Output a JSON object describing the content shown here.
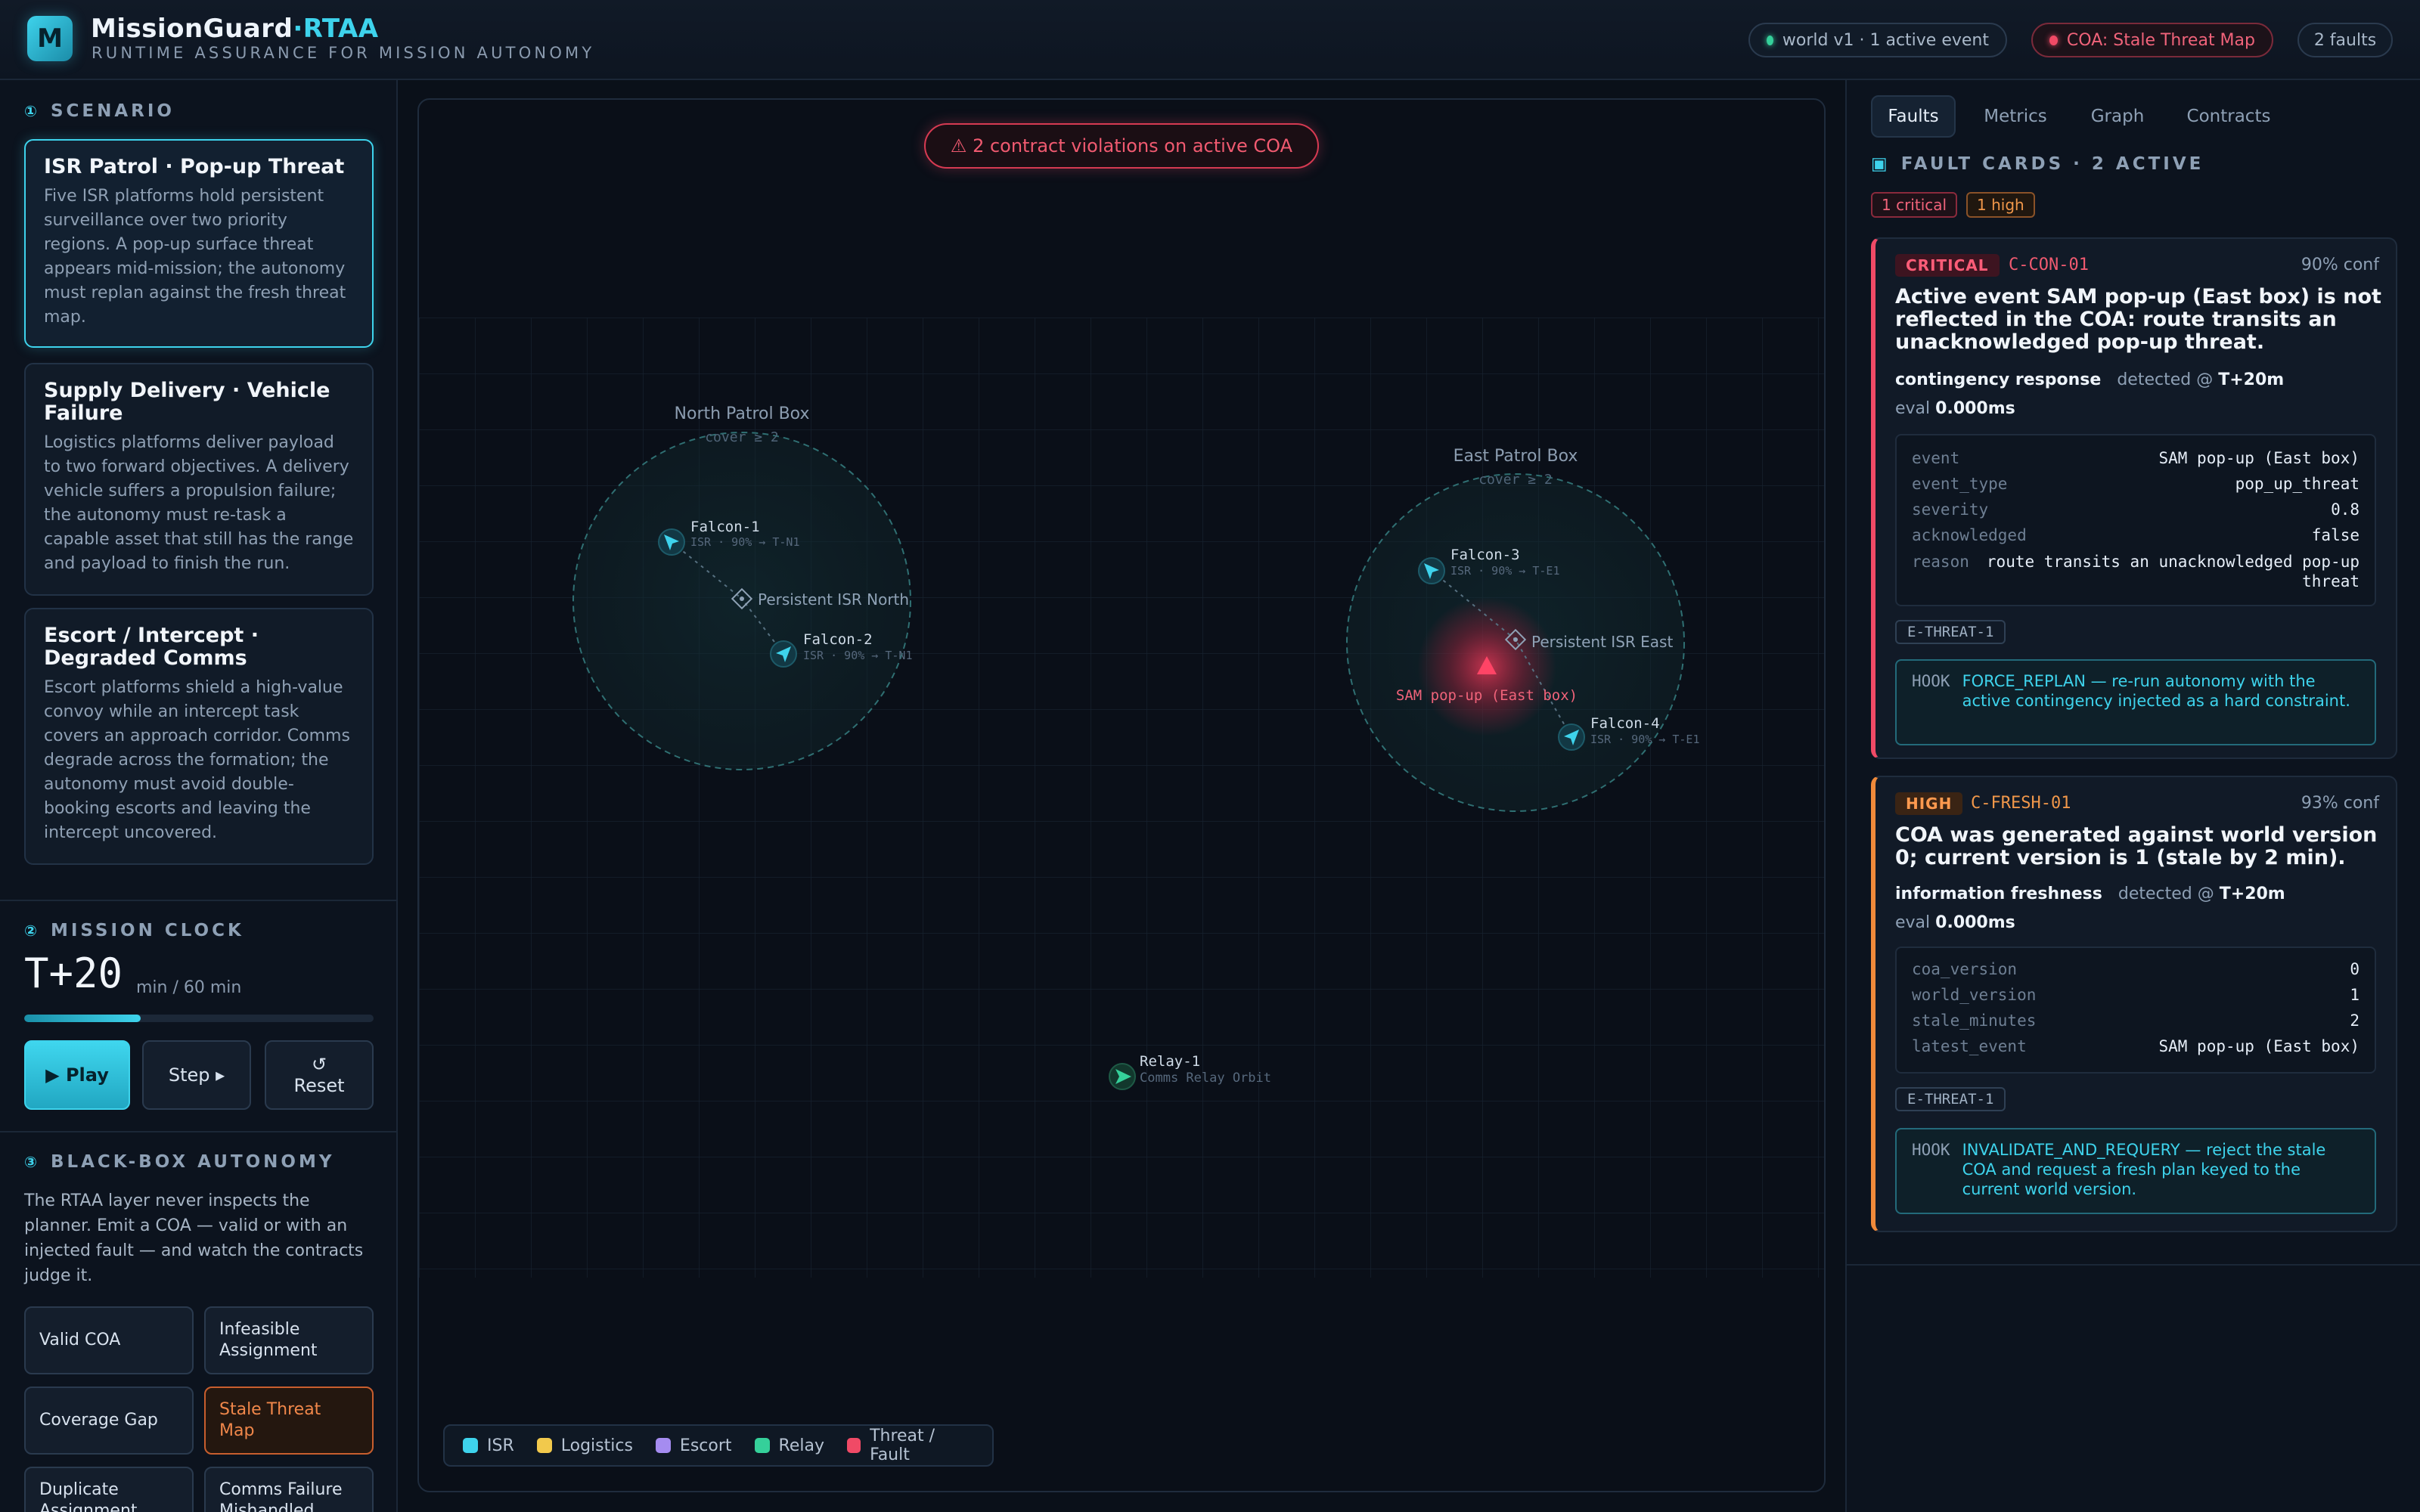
{
  "header": {
    "logo_letter": "M",
    "brand_main": "MissionGuard",
    "brand_accent": "·RTAA",
    "subtitle": "RUNTIME ASSURANCE FOR MISSION AUTONOMY",
    "world_pill": "world v1 · 1 active event",
    "coa_pill": "COA: Stale Threat Map",
    "faults_pill": "2 faults"
  },
  "scenario": {
    "section_num": "①",
    "section_title": "SCENARIO",
    "items": [
      {
        "title": "ISR Patrol · Pop-up Threat",
        "desc": "Five ISR platforms hold persistent surveillance over two priority regions. A pop-up surface threat appears mid-mission; the autonomy must replan against the fresh threat map."
      },
      {
        "title": "Supply Delivery · Vehicle Failure",
        "desc": "Logistics platforms deliver payload to two forward objectives. A delivery vehicle suffers a propulsion failure; the autonomy must re-task a capable asset that still has the range and payload to finish the run."
      },
      {
        "title": "Escort / Intercept · Degraded Comms",
        "desc": "Escort platforms shield a high-value convoy while an intercept task covers an approach corridor. Comms degrade across the formation; the autonomy must avoid double-booking escorts and leaving the intercept uncovered."
      }
    ]
  },
  "clock": {
    "section_num": "②",
    "section_title": "MISSION CLOCK",
    "time": "T+20",
    "unit": "min / 60 min",
    "progress": 0.333,
    "play_label": "▶ Play",
    "step_label": "Step ▸",
    "reset_icon": "↺",
    "reset_label": "Reset"
  },
  "blackbox": {
    "section_num": "③",
    "section_title": "BLACK-BOX AUTONOMY",
    "desc": "The RTAA layer never inspects the planner. Emit a COA — valid or with an injected fault — and watch the contracts judge it.",
    "buttons": [
      "Valid COA",
      "Infeasible Assignment",
      "Coverage Gap",
      "Stale Threat Map",
      "Duplicate Assignment",
      "Comms Failure Mishandled"
    ]
  },
  "map": {
    "violation_banner": "⚠ 2 contract violations on active COA",
    "north_box": {
      "label": "North Patrol Box",
      "cover": "cover ≥ 2",
      "objective": "Persistent ISR North"
    },
    "east_box": {
      "label": "East Patrol Box",
      "cover": "cover ≥ 2",
      "objective": "Persistent ISR East"
    },
    "threat_label": "SAM pop-up (East box)",
    "units": [
      {
        "name": "Falcon-1",
        "detail": "ISR · 90% → T-N1"
      },
      {
        "name": "Falcon-2",
        "detail": "ISR · 90% → T-N1"
      },
      {
        "name": "Falcon-3",
        "detail": "ISR · 90% → T-E1"
      },
      {
        "name": "Falcon-4",
        "detail": "ISR · 90% → T-E1"
      },
      {
        "name": "Relay-1",
        "detail": "Comms Relay Orbit"
      }
    ],
    "legend": [
      {
        "label": "ISR",
        "color": "#3ed3ec"
      },
      {
        "label": "Logistics",
        "color": "#f2c94c"
      },
      {
        "label": "Escort",
        "color": "#a58cf0"
      },
      {
        "label": "Relay",
        "color": "#35d09a"
      },
      {
        "label": "Threat / Fault",
        "color": "#f04a66"
      }
    ]
  },
  "right": {
    "tabs": [
      "Faults",
      "Metrics",
      "Graph",
      "Contracts"
    ],
    "fault_icon": "▣",
    "fault_title": "FAULT CARDS · 2 ACTIVE",
    "chip_critical": "1 critical",
    "chip_high": "1 high",
    "cards": [
      {
        "severity": "CRITICAL",
        "id": "C-CON-01",
        "conf": "90% conf",
        "headline": "Active event SAM pop-up (East box) is not reflected in the COA: route transits an unacknowledged pop-up threat.",
        "category": "contingency response",
        "detected_prefix": "detected @",
        "detected": "T+20m",
        "eval_prefix": "eval",
        "eval": "0.000ms",
        "kv": [
          {
            "k": "event",
            "v": "SAM pop-up (East box)"
          },
          {
            "k": "event_type",
            "v": "pop_up_threat"
          },
          {
            "k": "severity",
            "v": "0.8"
          },
          {
            "k": "acknowledged",
            "v": "false"
          },
          {
            "k": "reason",
            "v": "route transits an unacknowledged pop-up threat"
          }
        ],
        "tag": "E-THREAT-1",
        "hook_key": "HOOK",
        "hook": "FORCE_REPLAN — re-run autonomy with the active contingency injected as a hard constraint."
      },
      {
        "severity": "HIGH",
        "id": "C-FRESH-01",
        "conf": "93% conf",
        "headline": "COA was generated against world version 0; current version is 1 (stale by 2 min).",
        "category": "information freshness",
        "detected_prefix": "detected @",
        "detected": "T+20m",
        "eval_prefix": "eval",
        "eval": "0.000ms",
        "kv": [
          {
            "k": "coa_version",
            "v": "0"
          },
          {
            "k": "world_version",
            "v": "1"
          },
          {
            "k": "stale_minutes",
            "v": "2"
          },
          {
            "k": "latest_event",
            "v": "SAM pop-up (East box)"
          }
        ],
        "tag": "E-THREAT-1",
        "hook_key": "HOOK",
        "hook": "INVALIDATE_AND_REQUERY — reject the stale COA and request a fresh plan keyed to the current world version."
      }
    ]
  }
}
